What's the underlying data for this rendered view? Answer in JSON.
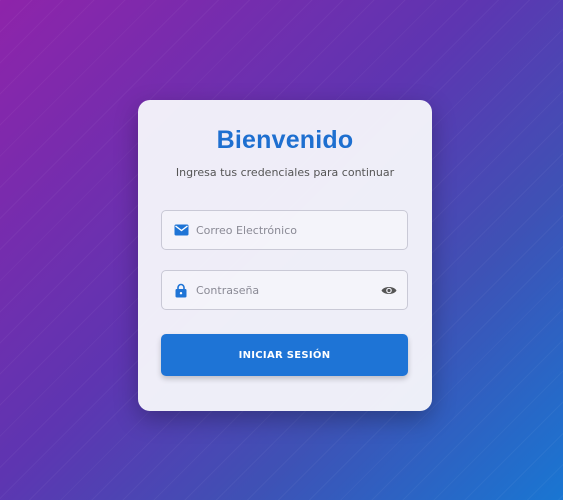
{
  "login": {
    "title": "Bienvenido",
    "subtitle": "Ingresa tus credenciales para continuar",
    "email": {
      "placeholder": "Correo Electrónico",
      "value": "",
      "icon": "email-icon"
    },
    "password": {
      "placeholder": "Contraseña",
      "value": "",
      "icon": "lock-icon",
      "toggle_icon": "eye-icon"
    },
    "submit_label": "INICIAR SESIÓN"
  },
  "colors": {
    "accent": "#1e74d6",
    "title": "#1e6fd0",
    "background_start": "#8e24aa",
    "background_end": "#1976d2"
  }
}
